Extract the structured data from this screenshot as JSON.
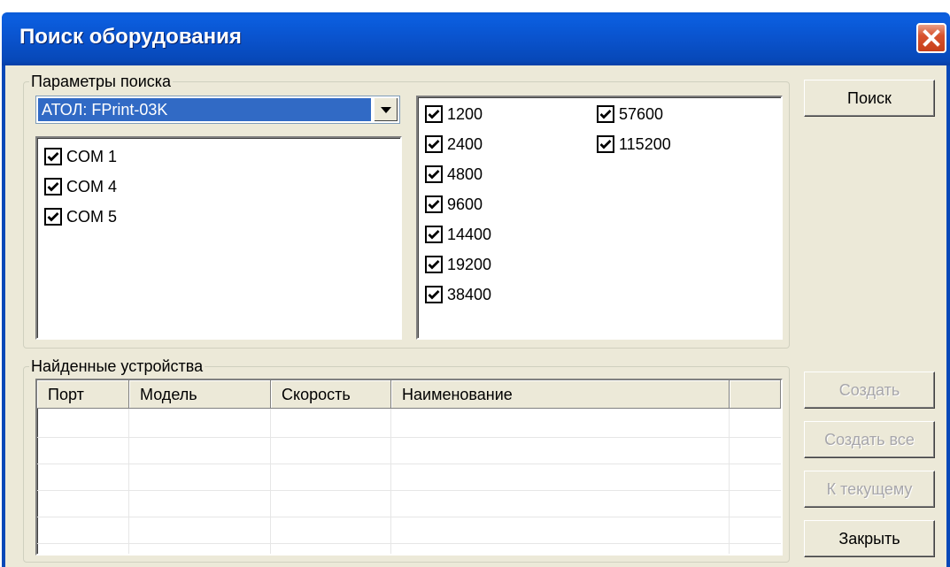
{
  "window": {
    "title": "Поиск оборудования"
  },
  "search_params": {
    "group_label": "Параметры поиска",
    "model_selected": "АТОЛ: FPrint-03K",
    "ports": [
      {
        "label": "COM 1",
        "checked": true
      },
      {
        "label": "COM 4",
        "checked": true
      },
      {
        "label": "COM 5",
        "checked": true
      }
    ],
    "speeds": [
      {
        "label": "1200",
        "checked": true
      },
      {
        "label": "2400",
        "checked": true
      },
      {
        "label": "4800",
        "checked": true
      },
      {
        "label": "9600",
        "checked": true
      },
      {
        "label": "14400",
        "checked": true
      },
      {
        "label": "19200",
        "checked": true
      },
      {
        "label": "38400",
        "checked": true
      },
      {
        "label": "57600",
        "checked": true
      },
      {
        "label": "115200",
        "checked": true
      }
    ]
  },
  "found_devices": {
    "group_label": "Найденные устройства",
    "columns": [
      "Порт",
      "Модель",
      "Скорость",
      "Наименование"
    ],
    "rows": []
  },
  "buttons": {
    "search": "Поиск",
    "create": "Создать",
    "create_all": "Создать все",
    "to_current": "К текущему",
    "close": "Закрыть"
  },
  "colors": {
    "titlebar": "#0a54cf",
    "selection": "#316ac5",
    "dialog_bg": "#ece9d8",
    "close_button": "#d8532f"
  }
}
